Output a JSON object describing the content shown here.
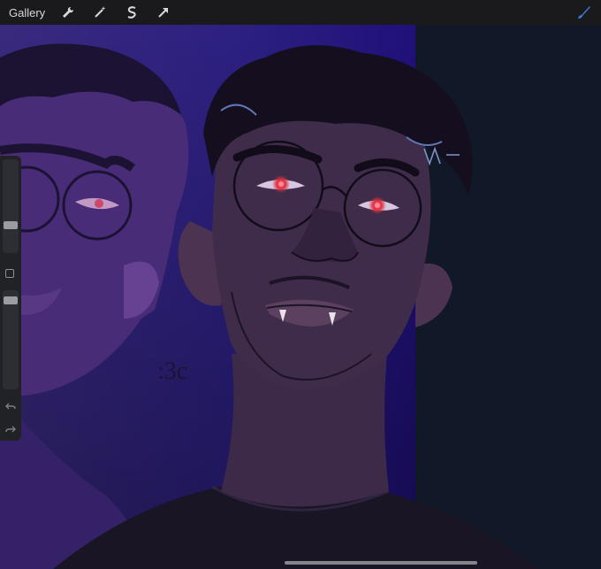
{
  "toolbar": {
    "gallery_label": "Gallery",
    "tools": [
      {
        "name": "wrench-icon"
      },
      {
        "name": "magic-wand-icon"
      },
      {
        "name": "selection-s-icon"
      },
      {
        "name": "transform-arrow-icon"
      }
    ],
    "brush_icon": "brush-icon",
    "brush_color": "#3b7bd6"
  },
  "sidebar": {
    "brush_size_level": 0.28,
    "opacity_level": 0.93
  },
  "canvas": {
    "doodle_text": ":3c",
    "accent_eye_color": "#e0303e"
  }
}
